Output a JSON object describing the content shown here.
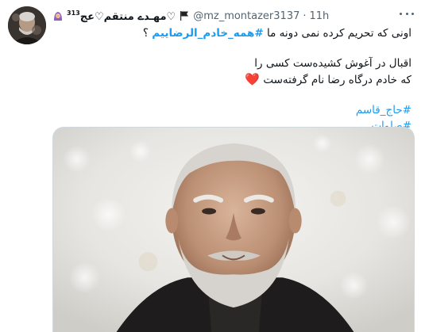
{
  "tweet": {
    "author": {
      "display_name": "مهـدے منتقم♡عج♡",
      "superscript": "313",
      "handle": "@mz_montazer3137",
      "separator": "·",
      "time": "11h"
    },
    "body": {
      "line1_prefix": "اونی که تحریم کرده نمی دونه ما",
      "line1_hashtag": "#همه_خادم_الرضاییم",
      "line1_suffix": "؟",
      "line2": "اقبال در آغوش کشیده‌ست کسی را",
      "line3": "که خادم درگاه رضا نام گرفته‌ست",
      "heart": "❤️",
      "hashtag1": "#حاج_قاسم",
      "hashtag2": "#صلوات"
    },
    "icons": {
      "avatar": "avatar",
      "girl_emoji": "woman-with-headscarf-icon",
      "flag": "black-flag-icon",
      "more": "more-options-icon",
      "heart": "red-heart-icon"
    },
    "colors": {
      "link": "#1d9bf0",
      "secondary_text": "#536471",
      "heart": "#e0245e"
    }
  }
}
